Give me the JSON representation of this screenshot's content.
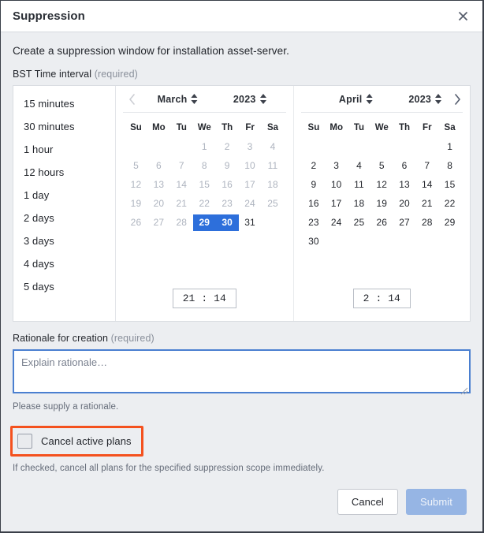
{
  "dialog": {
    "title": "Suppression",
    "close_icon": "close-icon",
    "intro": "Create a suppression window for installation asset-server."
  },
  "time_interval": {
    "label": "BST Time interval",
    "required_text": "(required)",
    "intervals": [
      "15 minutes",
      "30 minutes",
      "1 hour",
      "12 hours",
      "1 day",
      "2 days",
      "3 days",
      "4 days",
      "5 days"
    ],
    "prev_icon": "chevron-left-icon",
    "next_icon": "chevron-right-icon",
    "spinner_icon": "updown-spinner-icon",
    "weekdays": [
      "Su",
      "Mo",
      "Tu",
      "We",
      "Th",
      "Fr",
      "Sa"
    ],
    "calendars": [
      {
        "month": "March",
        "year": "2023",
        "prev_enabled": false,
        "next_enabled": false,
        "weeks": [
          [
            {
              "d": "",
              "state": "blank"
            },
            {
              "d": "",
              "state": "blank"
            },
            {
              "d": "",
              "state": "blank"
            },
            {
              "d": "1",
              "state": "muted"
            },
            {
              "d": "2",
              "state": "muted"
            },
            {
              "d": "3",
              "state": "muted"
            },
            {
              "d": "4",
              "state": "muted"
            }
          ],
          [
            {
              "d": "5",
              "state": "muted"
            },
            {
              "d": "6",
              "state": "muted"
            },
            {
              "d": "7",
              "state": "muted"
            },
            {
              "d": "8",
              "state": "muted"
            },
            {
              "d": "9",
              "state": "muted"
            },
            {
              "d": "10",
              "state": "muted"
            },
            {
              "d": "11",
              "state": "muted"
            }
          ],
          [
            {
              "d": "12",
              "state": "muted"
            },
            {
              "d": "13",
              "state": "muted"
            },
            {
              "d": "14",
              "state": "muted"
            },
            {
              "d": "15",
              "state": "muted"
            },
            {
              "d": "16",
              "state": "muted"
            },
            {
              "d": "17",
              "state": "muted"
            },
            {
              "d": "18",
              "state": "muted"
            }
          ],
          [
            {
              "d": "19",
              "state": "muted"
            },
            {
              "d": "20",
              "state": "muted"
            },
            {
              "d": "21",
              "state": "muted"
            },
            {
              "d": "22",
              "state": "muted"
            },
            {
              "d": "23",
              "state": "muted"
            },
            {
              "d": "24",
              "state": "muted"
            },
            {
              "d": "25",
              "state": "muted"
            }
          ],
          [
            {
              "d": "26",
              "state": "muted"
            },
            {
              "d": "27",
              "state": "muted"
            },
            {
              "d": "28",
              "state": "muted"
            },
            {
              "d": "29",
              "state": "selected"
            },
            {
              "d": "30",
              "state": "selected"
            },
            {
              "d": "31",
              "state": "normal"
            },
            {
              "d": "",
              "state": "blank"
            }
          ]
        ],
        "time": {
          "hour": "21",
          "separator": ":",
          "minute": "14"
        }
      },
      {
        "month": "April",
        "year": "2023",
        "prev_enabled": false,
        "next_enabled": true,
        "weeks": [
          [
            {
              "d": "",
              "state": "blank"
            },
            {
              "d": "",
              "state": "blank"
            },
            {
              "d": "",
              "state": "blank"
            },
            {
              "d": "",
              "state": "blank"
            },
            {
              "d": "",
              "state": "blank"
            },
            {
              "d": "",
              "state": "blank"
            },
            {
              "d": "1",
              "state": "normal"
            }
          ],
          [
            {
              "d": "2",
              "state": "normal"
            },
            {
              "d": "3",
              "state": "normal"
            },
            {
              "d": "4",
              "state": "normal"
            },
            {
              "d": "5",
              "state": "normal"
            },
            {
              "d": "6",
              "state": "normal"
            },
            {
              "d": "7",
              "state": "normal"
            },
            {
              "d": "8",
              "state": "normal"
            }
          ],
          [
            {
              "d": "9",
              "state": "normal"
            },
            {
              "d": "10",
              "state": "normal"
            },
            {
              "d": "11",
              "state": "normal"
            },
            {
              "d": "12",
              "state": "normal"
            },
            {
              "d": "13",
              "state": "normal"
            },
            {
              "d": "14",
              "state": "normal"
            },
            {
              "d": "15",
              "state": "normal"
            }
          ],
          [
            {
              "d": "16",
              "state": "normal"
            },
            {
              "d": "17",
              "state": "normal"
            },
            {
              "d": "18",
              "state": "normal"
            },
            {
              "d": "19",
              "state": "normal"
            },
            {
              "d": "20",
              "state": "normal"
            },
            {
              "d": "21",
              "state": "normal"
            },
            {
              "d": "22",
              "state": "normal"
            }
          ],
          [
            {
              "d": "23",
              "state": "normal"
            },
            {
              "d": "24",
              "state": "normal"
            },
            {
              "d": "25",
              "state": "normal"
            },
            {
              "d": "26",
              "state": "normal"
            },
            {
              "d": "27",
              "state": "normal"
            },
            {
              "d": "28",
              "state": "normal"
            },
            {
              "d": "29",
              "state": "normal"
            }
          ],
          [
            {
              "d": "30",
              "state": "normal"
            },
            {
              "d": "",
              "state": "blank"
            },
            {
              "d": "",
              "state": "blank"
            },
            {
              "d": "",
              "state": "blank"
            },
            {
              "d": "",
              "state": "blank"
            },
            {
              "d": "",
              "state": "blank"
            },
            {
              "d": "",
              "state": "blank"
            }
          ]
        ],
        "time": {
          "hour": "2",
          "separator": ":",
          "minute": "14"
        }
      }
    ]
  },
  "rationale": {
    "label": "Rationale for creation",
    "required_text": "(required)",
    "placeholder": "Explain rationale…",
    "value": "",
    "help": "Please supply a rationale."
  },
  "cancel_plans": {
    "label": "Cancel active plans",
    "checked": false,
    "help": "If checked, cancel all plans for the specified suppression scope immediately.",
    "annotation_color": "#f4511e"
  },
  "footer": {
    "cancel_label": "Cancel",
    "submit_label": "Submit",
    "submit_enabled": false
  },
  "colors": {
    "selected_day": "#2d6fdb",
    "focus_border": "#4a7fd0",
    "submit_disabled": "#96b5e4",
    "annotation": "#f4511e",
    "body_bg": "#eceef1"
  }
}
